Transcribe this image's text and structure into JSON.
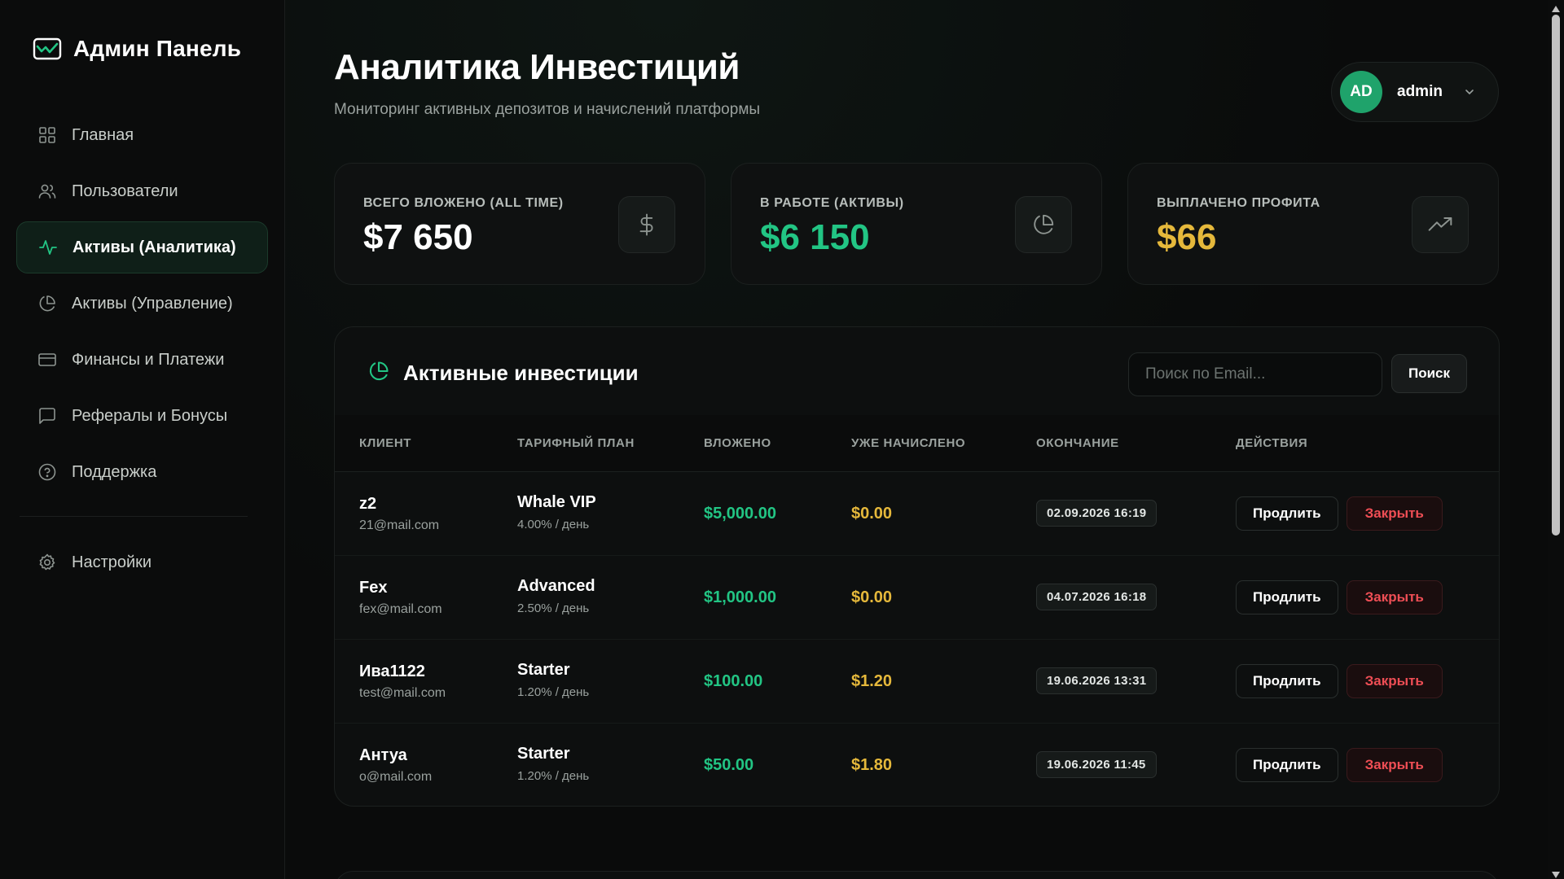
{
  "brand": {
    "title": "Админ Панель",
    "icon": "chart-window-icon"
  },
  "sidebar": {
    "items": [
      {
        "label": "Главная",
        "icon": "grid-icon",
        "active": false
      },
      {
        "label": "Пользователи",
        "icon": "users-icon",
        "active": false
      },
      {
        "label": "Активы (Аналитика)",
        "icon": "activity-icon",
        "active": true
      },
      {
        "label": "Активы (Управление)",
        "icon": "pie-chart-icon",
        "active": false
      },
      {
        "label": "Финансы и Платежи",
        "icon": "credit-card-icon",
        "active": false
      },
      {
        "label": "Рефералы и Бонусы",
        "icon": "message-square-icon",
        "active": false
      },
      {
        "label": "Поддержка",
        "icon": "help-circle-icon",
        "active": false
      }
    ],
    "settings": {
      "label": "Настройки",
      "icon": "gear-icon"
    }
  },
  "header": {
    "title": "Аналитика Инвестиций",
    "subtitle": "Мониторинг активных депозитов и начислений платформы"
  },
  "user": {
    "initials": "AD",
    "name": "admin"
  },
  "stats": [
    {
      "label": "ВСЕГО ВЛОЖЕНО (ALL TIME)",
      "value": "$7 650",
      "color": "#ffffff",
      "icon": "dollar-icon"
    },
    {
      "label": "В РАБОТЕ (АКТИВЫ)",
      "value": "$6 150",
      "color": "#22c584",
      "icon": "pie-chart-icon"
    },
    {
      "label": "ВЫПЛАЧЕНО ПРОФИТА",
      "value": "$66",
      "color": "#e5b83b",
      "icon": "trending-up-icon"
    }
  ],
  "panel": {
    "title": "Активные инвестиции",
    "search_placeholder": "Поиск по Email...",
    "search_button": "Поиск",
    "columns": [
      "КЛИЕНТ",
      "ТАРИФНЫЙ ПЛАН",
      "ВЛОЖЕНО",
      "УЖЕ НАЧИСЛЕНО",
      "ОКОНЧАНИЕ",
      "ДЕЙСТВИЯ"
    ],
    "extend_label": "Продлить",
    "close_label": "Закрыть",
    "rows": [
      {
        "name": "z2",
        "email": "21@mail.com",
        "plan": "Whale VIP",
        "rate": "4.00% / день",
        "invested": "$5,000.00",
        "accrued": "$0.00",
        "end": "02.09.2026 16:19"
      },
      {
        "name": "Fex",
        "email": "fex@mail.com",
        "plan": "Advanced",
        "rate": "2.50% / день",
        "invested": "$1,000.00",
        "accrued": "$0.00",
        "end": "04.07.2026 16:18"
      },
      {
        "name": "Ива1122",
        "email": "test@mail.com",
        "plan": "Starter",
        "rate": "1.20% / день",
        "invested": "$100.00",
        "accrued": "$1.20",
        "end": "19.06.2026 13:31"
      },
      {
        "name": "Антуа",
        "email": "o@mail.com",
        "plan": "Starter",
        "rate": "1.20% / день",
        "invested": "$50.00",
        "accrued": "$1.80",
        "end": "19.06.2026 11:45"
      }
    ]
  },
  "colors": {
    "accent": "#22c584",
    "gold": "#e5b83b",
    "danger": "#ef4e55",
    "background": "#0a0b0b"
  }
}
